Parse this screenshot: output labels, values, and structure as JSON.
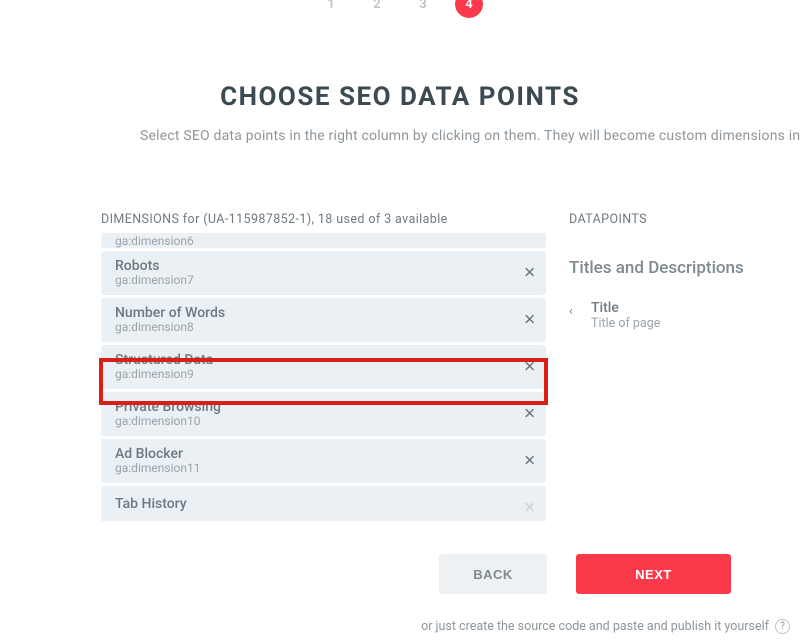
{
  "stepper": {
    "steps": [
      "1",
      "2",
      "3",
      "4"
    ],
    "active_index": 3
  },
  "header": {
    "title": "CHOOSE SEO DATA POINTS",
    "subtitle": "Select SEO data points in the right column by clicking on them. They will become custom dimensions in y"
  },
  "dimensions": {
    "label": "DIMENSIONS for (UA-115987852-1), 18 used of 3 available",
    "items": [
      {
        "name": "",
        "sub": "ga:dimension6",
        "peek": "top"
      },
      {
        "name": "Robots",
        "sub": "ga:dimension7"
      },
      {
        "name": "Number of Words",
        "sub": "ga:dimension8"
      },
      {
        "name": "Structured Data",
        "sub": "ga:dimension9",
        "highlighted": true
      },
      {
        "name": "Private Browsing",
        "sub": "ga:dimension10"
      },
      {
        "name": "Ad Blocker",
        "sub": "ga:dimension11"
      },
      {
        "name": "Tab History",
        "sub": "",
        "peek": "bottom"
      }
    ]
  },
  "datapoints": {
    "label": "DATAPOINTS",
    "group": "Titles and Descriptions",
    "item": {
      "label": "Title",
      "desc": "Title of page"
    }
  },
  "buttons": {
    "back": "BACK",
    "next": "NEXT"
  },
  "footer": {
    "note": "or just create the source code and paste and publish it yourself",
    "help": "?"
  }
}
